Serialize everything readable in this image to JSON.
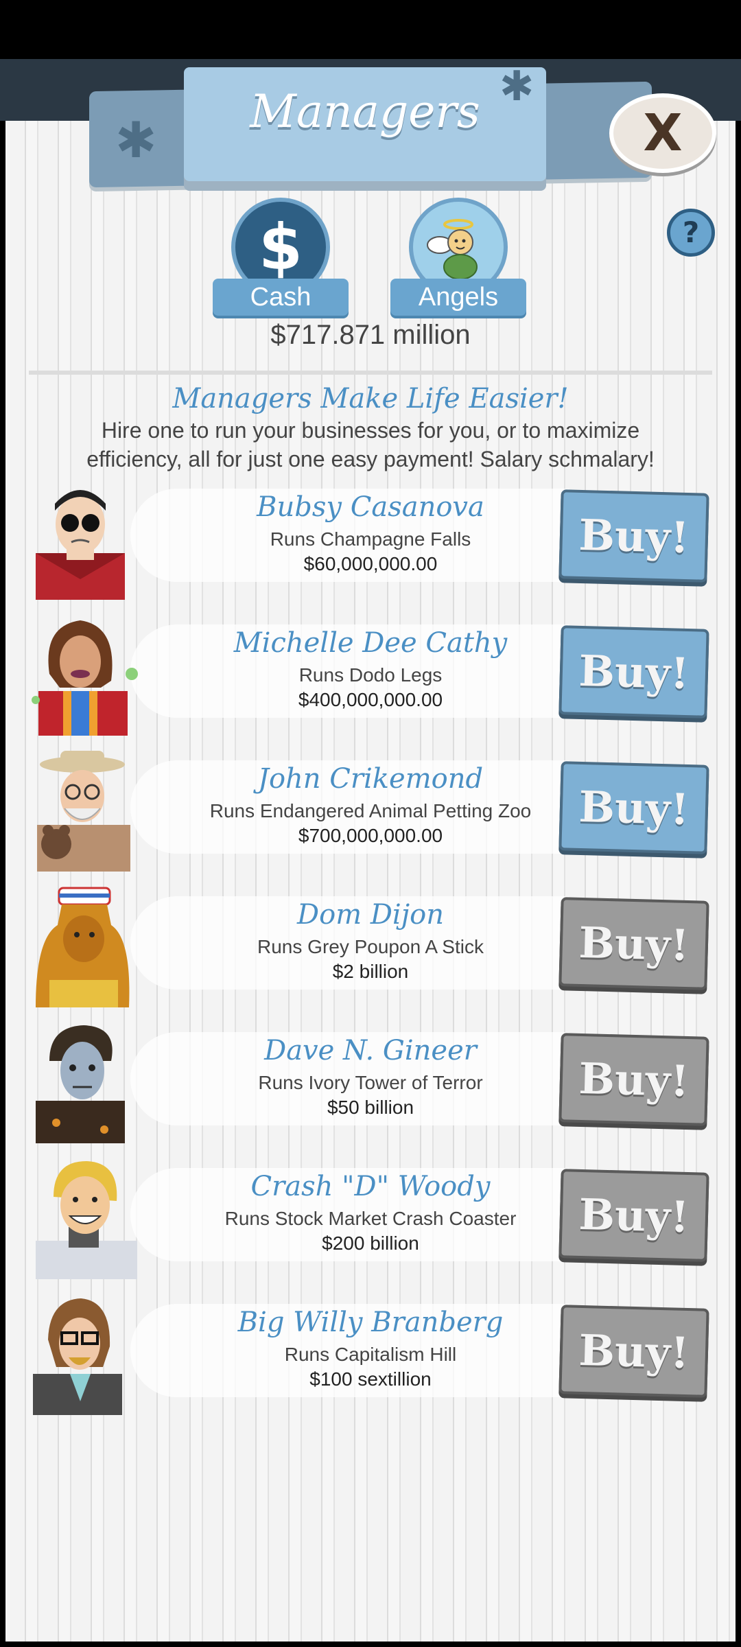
{
  "header": {
    "title": "Managers",
    "close_label": "X"
  },
  "tabs": [
    {
      "label": "Cash",
      "icon": "dollar-icon"
    },
    {
      "label": "Angels",
      "icon": "angel-icon"
    }
  ],
  "help_label": "?",
  "balance": "$717.871 million",
  "tagline": "Managers Make Life Easier!",
  "description": "Hire one to run your businesses for you, or to maximize efficiency, all for just one easy payment! Salary schmalary!",
  "buy_label": "Buy!",
  "managers": [
    {
      "name": "Bubsy Casanova",
      "runs": "Runs Champagne Falls",
      "price": "$60,000,000.00",
      "affordable": true
    },
    {
      "name": "Michelle Dee Cathy",
      "runs": "Runs Dodo Legs",
      "price": "$400,000,000.00",
      "affordable": true
    },
    {
      "name": "John Crikemond",
      "runs": "Runs Endangered Animal Petting Zoo",
      "price": "$700,000,000.00",
      "affordable": true
    },
    {
      "name": "Dom Dijon",
      "runs": "Runs Grey Poupon A Stick",
      "price": "$2 billion",
      "affordable": false
    },
    {
      "name": "Dave N. Gineer",
      "runs": "Runs Ivory Tower of Terror",
      "price": "$50 billion",
      "affordable": false
    },
    {
      "name": "Crash \"D\" Woody",
      "runs": "Runs Stock Market Crash Coaster",
      "price": "$200 billion",
      "affordable": false
    },
    {
      "name": "Big Willy Branberg",
      "runs": "Runs Capitalism Hill",
      "price": "$100 sextillion",
      "affordable": false
    }
  ],
  "colors": {
    "accent": "#4a8fc4",
    "buy_active": "#7eb0d4",
    "buy_inactive": "#9b9b9b"
  }
}
